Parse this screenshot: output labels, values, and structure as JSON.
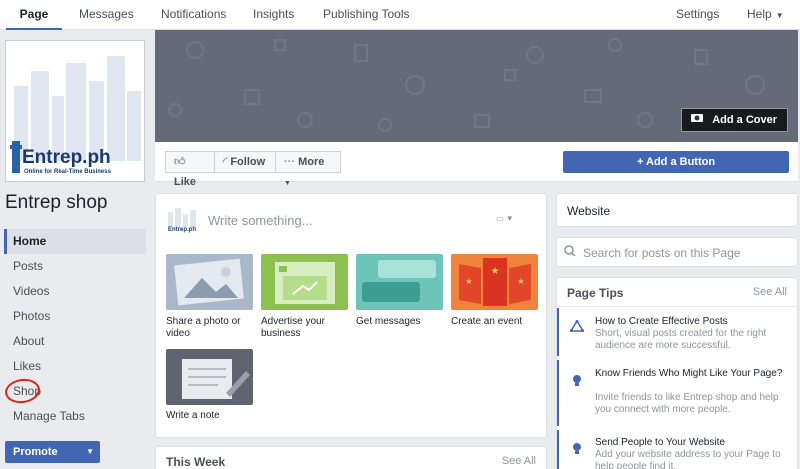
{
  "topnav": {
    "tabs": [
      "Page",
      "Messages",
      "Notifications",
      "Insights",
      "Publishing Tools"
    ],
    "settings": "Settings",
    "help": "Help"
  },
  "profile": {
    "logo_text": "Entrep.ph",
    "logo_tagline": "Online for Real-Time Business",
    "page_name": "Entrep shop"
  },
  "sidebar": {
    "items": [
      "Home",
      "Posts",
      "Videos",
      "Photos",
      "About",
      "Likes",
      "Shop",
      "Manage Tabs"
    ],
    "active": "Home",
    "promote": "Promote"
  },
  "cover": {
    "add_cover": "Add a Cover"
  },
  "actions": {
    "like": "Like",
    "follow": "Follow",
    "more": "More",
    "add_button": "+ Add a Button"
  },
  "composer": {
    "placeholder": "Write something...",
    "tiles": [
      {
        "label": "Share a photo or video",
        "color": "#a9b8c9"
      },
      {
        "label": "Advertise your business",
        "color": "#8cc152"
      },
      {
        "label": "Get messages",
        "color": "#6dc5b9"
      },
      {
        "label": "Create an event",
        "color": "#f1843c"
      },
      {
        "label": "Write a note",
        "color": "#5f6470"
      }
    ]
  },
  "thisweek": {
    "title": "This Week",
    "see_all": "See All"
  },
  "right": {
    "website": "Website",
    "search_placeholder": "Search for posts on this Page",
    "tips_title": "Page Tips",
    "tips_see_all": "See All",
    "tips": [
      {
        "title": "How to Create Effective Posts",
        "body": "Short, visual posts created for the right audience are more successful."
      },
      {
        "title": "Know Friends Who Might Like Your Page?",
        "body": "Invite friends to like Entrep shop and help you connect with more people."
      },
      {
        "title": "Send People to Your Website",
        "body": "Add your website address to your Page to help people find it."
      }
    ]
  },
  "colors": {
    "brand_blue": "#4267b2",
    "annotation_red": "#e0201a"
  }
}
